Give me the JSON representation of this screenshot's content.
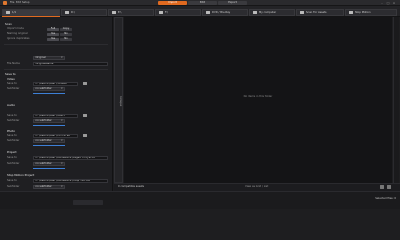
{
  "titlebar": {
    "menu": [
      "File",
      "Edit",
      "Setup"
    ],
    "modes": [
      "Import",
      "Edit",
      "Export"
    ],
    "active_mode": "Import",
    "window_controls": [
      "minimize-icon",
      "maximize-icon",
      "close-icon"
    ]
  },
  "tabs": [
    {
      "label": "1/1",
      "icon": "tab-icon"
    },
    {
      "label": "D:\\",
      "icon": "drive-icon"
    },
    {
      "label": "E:\\",
      "icon": "drive-icon"
    },
    {
      "label": "F:\\",
      "icon": "drive-icon"
    },
    {
      "label": "DVD / Blu-Ray",
      "icon": "disc-icon"
    },
    {
      "label": "My computer",
      "icon": "computer-icon"
    },
    {
      "label": "Scan For Assets",
      "icon": "scan-icon"
    },
    {
      "label": "Stop Motion",
      "icon": "camera-icon"
    }
  ],
  "left_panel": {
    "scan_title": "Scan",
    "scan_rows": [
      {
        "label": "Import mode",
        "options": [
          "Full",
          "Copy"
        ]
      },
      {
        "label": "Naming original",
        "options": [
          "Yes",
          "No"
        ]
      },
      {
        "label": "Ignore duplicates",
        "options": [
          "Yes",
          "No"
        ]
      }
    ],
    "original_dropdown": "Original",
    "file_name_label": "File Name",
    "file_name_value": "OriginalName",
    "save_to_title": "Save to",
    "groups": [
      {
        "title": "Video",
        "save_label": "Save to",
        "path": "C:\\Users\\user\\Videos",
        "sub_label": "Subfolder",
        "sub_value": "no subfolder"
      },
      {
        "title": "Audio",
        "save_label": "Save to",
        "path": "C:\\Users\\user\\Music",
        "sub_label": "Subfolder",
        "sub_value": "no subfolder"
      },
      {
        "title": "Photo",
        "save_label": "Save to",
        "path": "C:\\Users\\user\\Pictures",
        "sub_label": "Subfolder",
        "sub_value": "no subfolder"
      },
      {
        "title": "Project",
        "save_label": "Save to",
        "path": "C:\\Users\\user\\Documents\\Vegas Projects",
        "sub_label": "Subfolder",
        "sub_value": "no subfolder"
      },
      {
        "title": "Stop Motion Project",
        "save_label": "Save to",
        "path": "C:\\Users\\user\\Documents\\Stop Motion",
        "sub_label": "Subfolder",
        "sub_value": "no subfolder"
      }
    ]
  },
  "collapse_label": "Collapse",
  "main": {
    "empty_message": "No items in this folder",
    "status_left": "0 compatible assets",
    "status_mid": "View as Grid / List"
  },
  "footer": {
    "right_text": "Selected files: 0"
  },
  "colors": {
    "accent": "#e06a20",
    "bg": "#1e1e20",
    "link": "#3d7fd6"
  }
}
